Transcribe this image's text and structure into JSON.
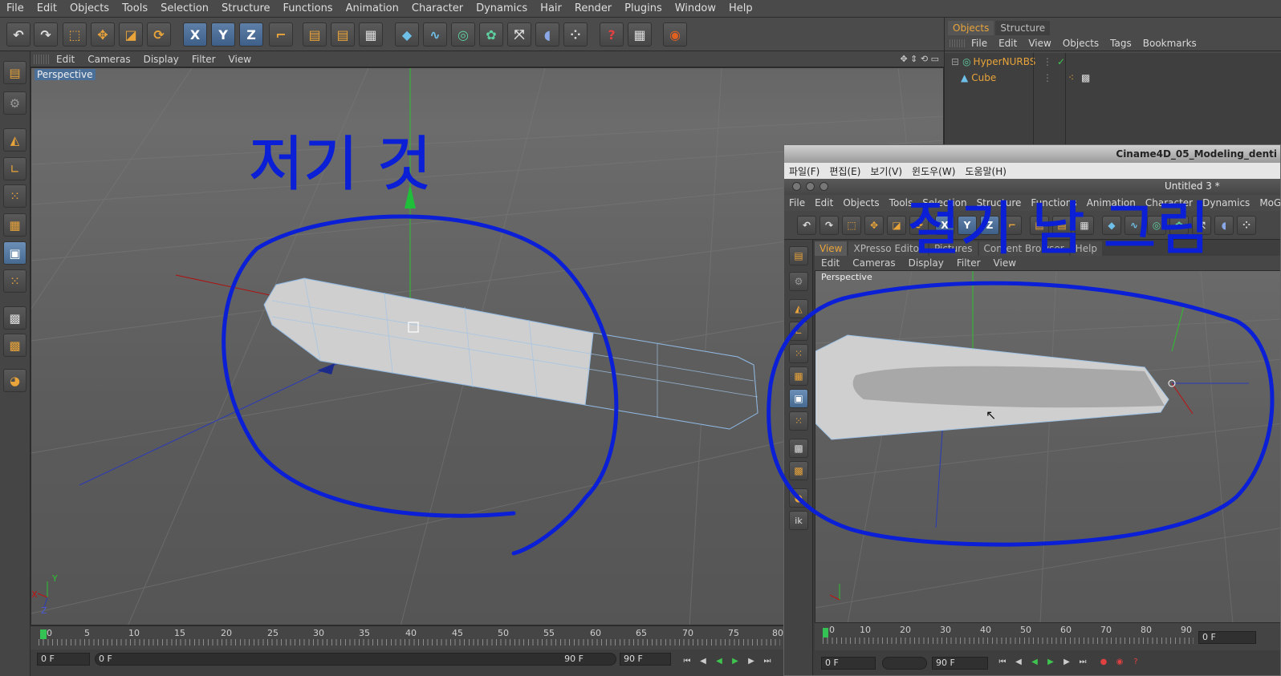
{
  "menubar": [
    "File",
    "Edit",
    "Objects",
    "Tools",
    "Selection",
    "Structure",
    "Functions",
    "Animation",
    "Character",
    "Dynamics",
    "Hair",
    "Render",
    "Plugins",
    "Window",
    "Help"
  ],
  "toolbar": {
    "axis_x": "X",
    "axis_y": "Y",
    "axis_z": "Z"
  },
  "viewport": {
    "menu": [
      "Edit",
      "Cameras",
      "Display",
      "Filter",
      "View"
    ],
    "label": "Perspective",
    "axis_x": "X",
    "axis_y": "Y",
    "axis_z": "Z"
  },
  "timeline": {
    "ticks": [
      "0",
      "5",
      "10",
      "15",
      "20",
      "25",
      "30",
      "35",
      "40",
      "45",
      "50",
      "55",
      "60",
      "65",
      "70",
      "75",
      "80"
    ],
    "current_frame": "0 F",
    "start_field": "0 F",
    "end_field": "90 F",
    "max_field": "90 F"
  },
  "objects_panel": {
    "tabs": [
      "Objects",
      "Structure"
    ],
    "menu": [
      "File",
      "Edit",
      "View",
      "Objects",
      "Tags",
      "Bookmarks"
    ],
    "items": [
      {
        "name": "HyperNURBS"
      },
      {
        "name": "Cube"
      }
    ]
  },
  "video_window": {
    "title": "Ciname4D_05_Modeling_denti",
    "menu": [
      "파일(F)",
      "편집(E)",
      "보기(V)",
      "윈도우(W)",
      "도움말(H)"
    ],
    "doc_title": "Untitled 3 *",
    "app_menu": [
      "File",
      "Edit",
      "Objects",
      "Tools",
      "Selection",
      "Structure",
      "Functions",
      "Animation",
      "Character",
      "Dynamics",
      "MoGraph"
    ],
    "tabs": [
      "View",
      "XPresso Editor",
      "Pictures",
      "Content Browser",
      "Help"
    ],
    "vp_menu": [
      "Edit",
      "Cameras",
      "Display",
      "Filter",
      "View"
    ],
    "vp_label": "Perspective",
    "timeline_ticks": [
      "0",
      "10",
      "20",
      "30",
      "40",
      "50",
      "60",
      "70",
      "80",
      "90"
    ],
    "frame_field": "0 F",
    "start_field": "0 F",
    "end_field": "90 F",
    "ik_label": "ik"
  },
  "annotation_text": {
    "left": "저기 것",
    "right": "절기 남 그림"
  },
  "colors": {
    "annotation_ink": "#0a1fd6",
    "accent": "#e9a43a",
    "selection_blue": "#4a6f99"
  }
}
